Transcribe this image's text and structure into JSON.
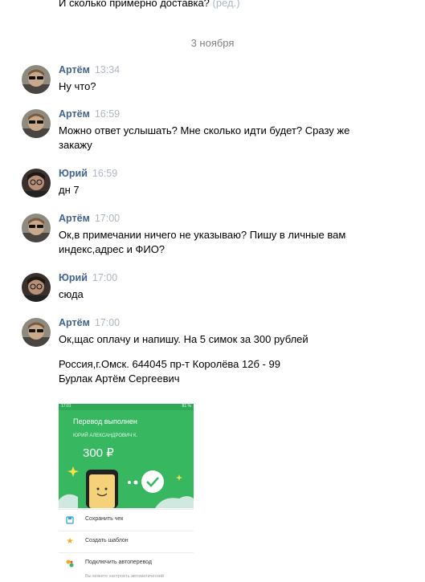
{
  "top_partial": {
    "text": "И сколько примерно доставка?",
    "edited": "(ред.)"
  },
  "date_separator": "3 ноября",
  "messages": [
    {
      "author": "Артём",
      "time": "13:34",
      "lines": [
        "Ну что?"
      ]
    },
    {
      "author": "Артём",
      "time": "16:59",
      "lines": [
        "Можно ответ услышать? Мне сколько идти будет? Сразу же",
        "закажу"
      ]
    },
    {
      "author": "Юрий",
      "time": "16:59",
      "lines": [
        "дн 7"
      ]
    },
    {
      "author": "Артём",
      "time": "17:00",
      "lines": [
        "Ок,в примечании ничего не указываю? Пишу в личные вам",
        "индекс,адрес и ФИО?"
      ]
    },
    {
      "author": "Юрий",
      "time": "17:00",
      "lines": [
        "сюда"
      ]
    },
    {
      "author": "Артём",
      "time": "17:00",
      "lines": [
        "Ок,щас оплачу и напишу. На 5 симок за 300 рублей"
      ]
    }
  ],
  "address": {
    "line1": "Россия,г.Омск. 644045 пр-т Королёва 12б - 99",
    "line2": "Бурлак Артём Сергеевич"
  },
  "attachment": {
    "status_time": "17:01",
    "status_battery": "81 %",
    "title": "Перевод выполнен",
    "recipient": "ЮРИЙ АЛЕКСАНДРОВИЧ К.",
    "amount": "300 ₽",
    "menu": [
      {
        "label": "Сохранить чек",
        "icon": "save-icon"
      },
      {
        "label": "Создать шаблон",
        "icon": "star-icon"
      },
      {
        "label": "Подключить автоперевод",
        "icon": "autopay-icon"
      }
    ],
    "hint": "Вы можете настроить автоматический"
  },
  "colors": {
    "author": "#42648b",
    "meta": "#aeb7c2",
    "date": "#828282",
    "sber_green": "#36b760"
  }
}
